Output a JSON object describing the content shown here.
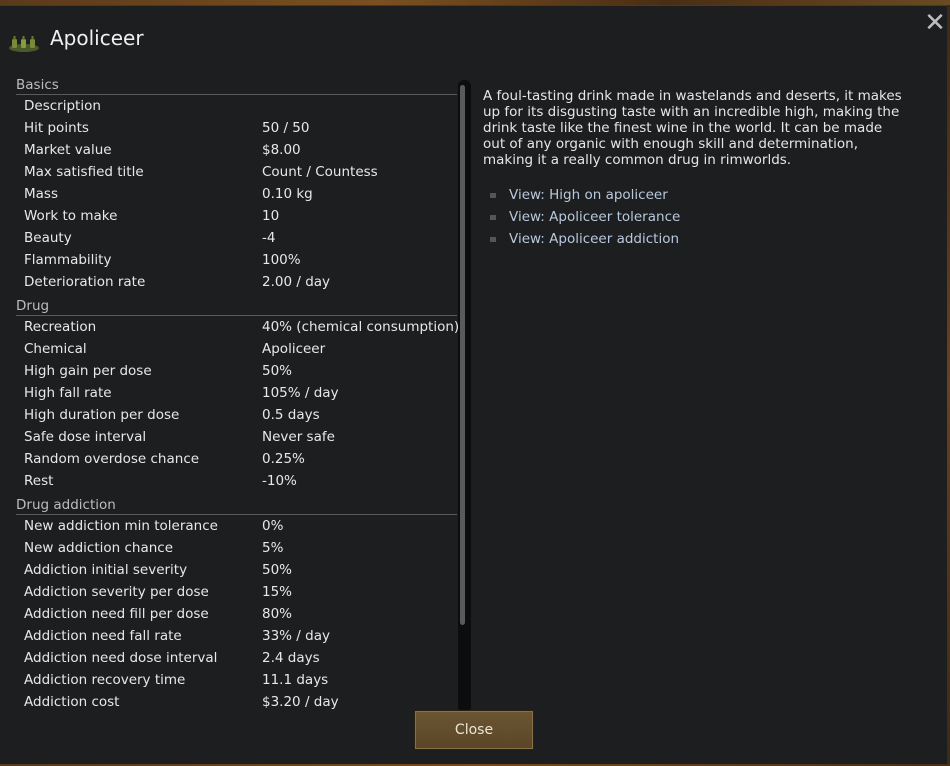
{
  "window": {
    "title": "Apoliceer"
  },
  "icons": {
    "close": "close-icon",
    "item": "apoliceer-bottles-icon"
  },
  "sections": [
    {
      "header": "Basics",
      "rows": [
        {
          "label": "Description",
          "value": ""
        },
        {
          "label": "Hit points",
          "value": "50 / 50"
        },
        {
          "label": "Market value",
          "value": "$8.00"
        },
        {
          "label": "Max satisfied title",
          "value": "Count / Countess"
        },
        {
          "label": "Mass",
          "value": "0.10 kg"
        },
        {
          "label": "Work to make",
          "value": "10"
        },
        {
          "label": "Beauty",
          "value": "-4"
        },
        {
          "label": "Flammability",
          "value": "100%"
        },
        {
          "label": "Deterioration rate",
          "value": "2.00 / day"
        }
      ]
    },
    {
      "header": "Drug",
      "rows": [
        {
          "label": "Recreation",
          "value": "40% (chemical consumption)"
        },
        {
          "label": "Chemical",
          "value": "Apoliceer"
        },
        {
          "label": "High gain per dose",
          "value": "50%"
        },
        {
          "label": "High fall rate",
          "value": "105% / day"
        },
        {
          "label": "High duration per dose",
          "value": "0.5 days"
        },
        {
          "label": "Safe dose interval",
          "value": "Never safe"
        },
        {
          "label": "Random overdose chance",
          "value": "0.25%"
        },
        {
          "label": "Rest",
          "value": "-10%"
        }
      ]
    },
    {
      "header": "Drug addiction",
      "rows": [
        {
          "label": "New addiction min tolerance",
          "value": "0%"
        },
        {
          "label": "New addiction chance",
          "value": "5%"
        },
        {
          "label": "Addiction initial severity",
          "value": "50%"
        },
        {
          "label": "Addiction severity per dose",
          "value": "15%"
        },
        {
          "label": "Addiction need fill per dose",
          "value": "80%"
        },
        {
          "label": "Addiction need fall rate",
          "value": "33% / day"
        },
        {
          "label": "Addiction need dose interval",
          "value": "2.4 days"
        },
        {
          "label": "Addiction recovery time",
          "value": "11.1 days"
        },
        {
          "label": "Addiction cost",
          "value": "$3.20 / day"
        }
      ]
    }
  ],
  "description": "A foul-tasting drink made in wastelands and deserts, it makes up for its disgusting taste with an incredible high, making the drink taste like the finest wine in the world. It can be made out of any organic with enough skill and determination, making it a really common drug in rimworlds.",
  "links": [
    "View: High on apoliceer",
    "View: Apoliceer tolerance",
    "View: Apoliceer addiction"
  ],
  "buttons": {
    "close": "Close"
  },
  "colors": {
    "link": "#b9c8dc",
    "button": "#6b5532",
    "background": "#1d1e1f"
  }
}
